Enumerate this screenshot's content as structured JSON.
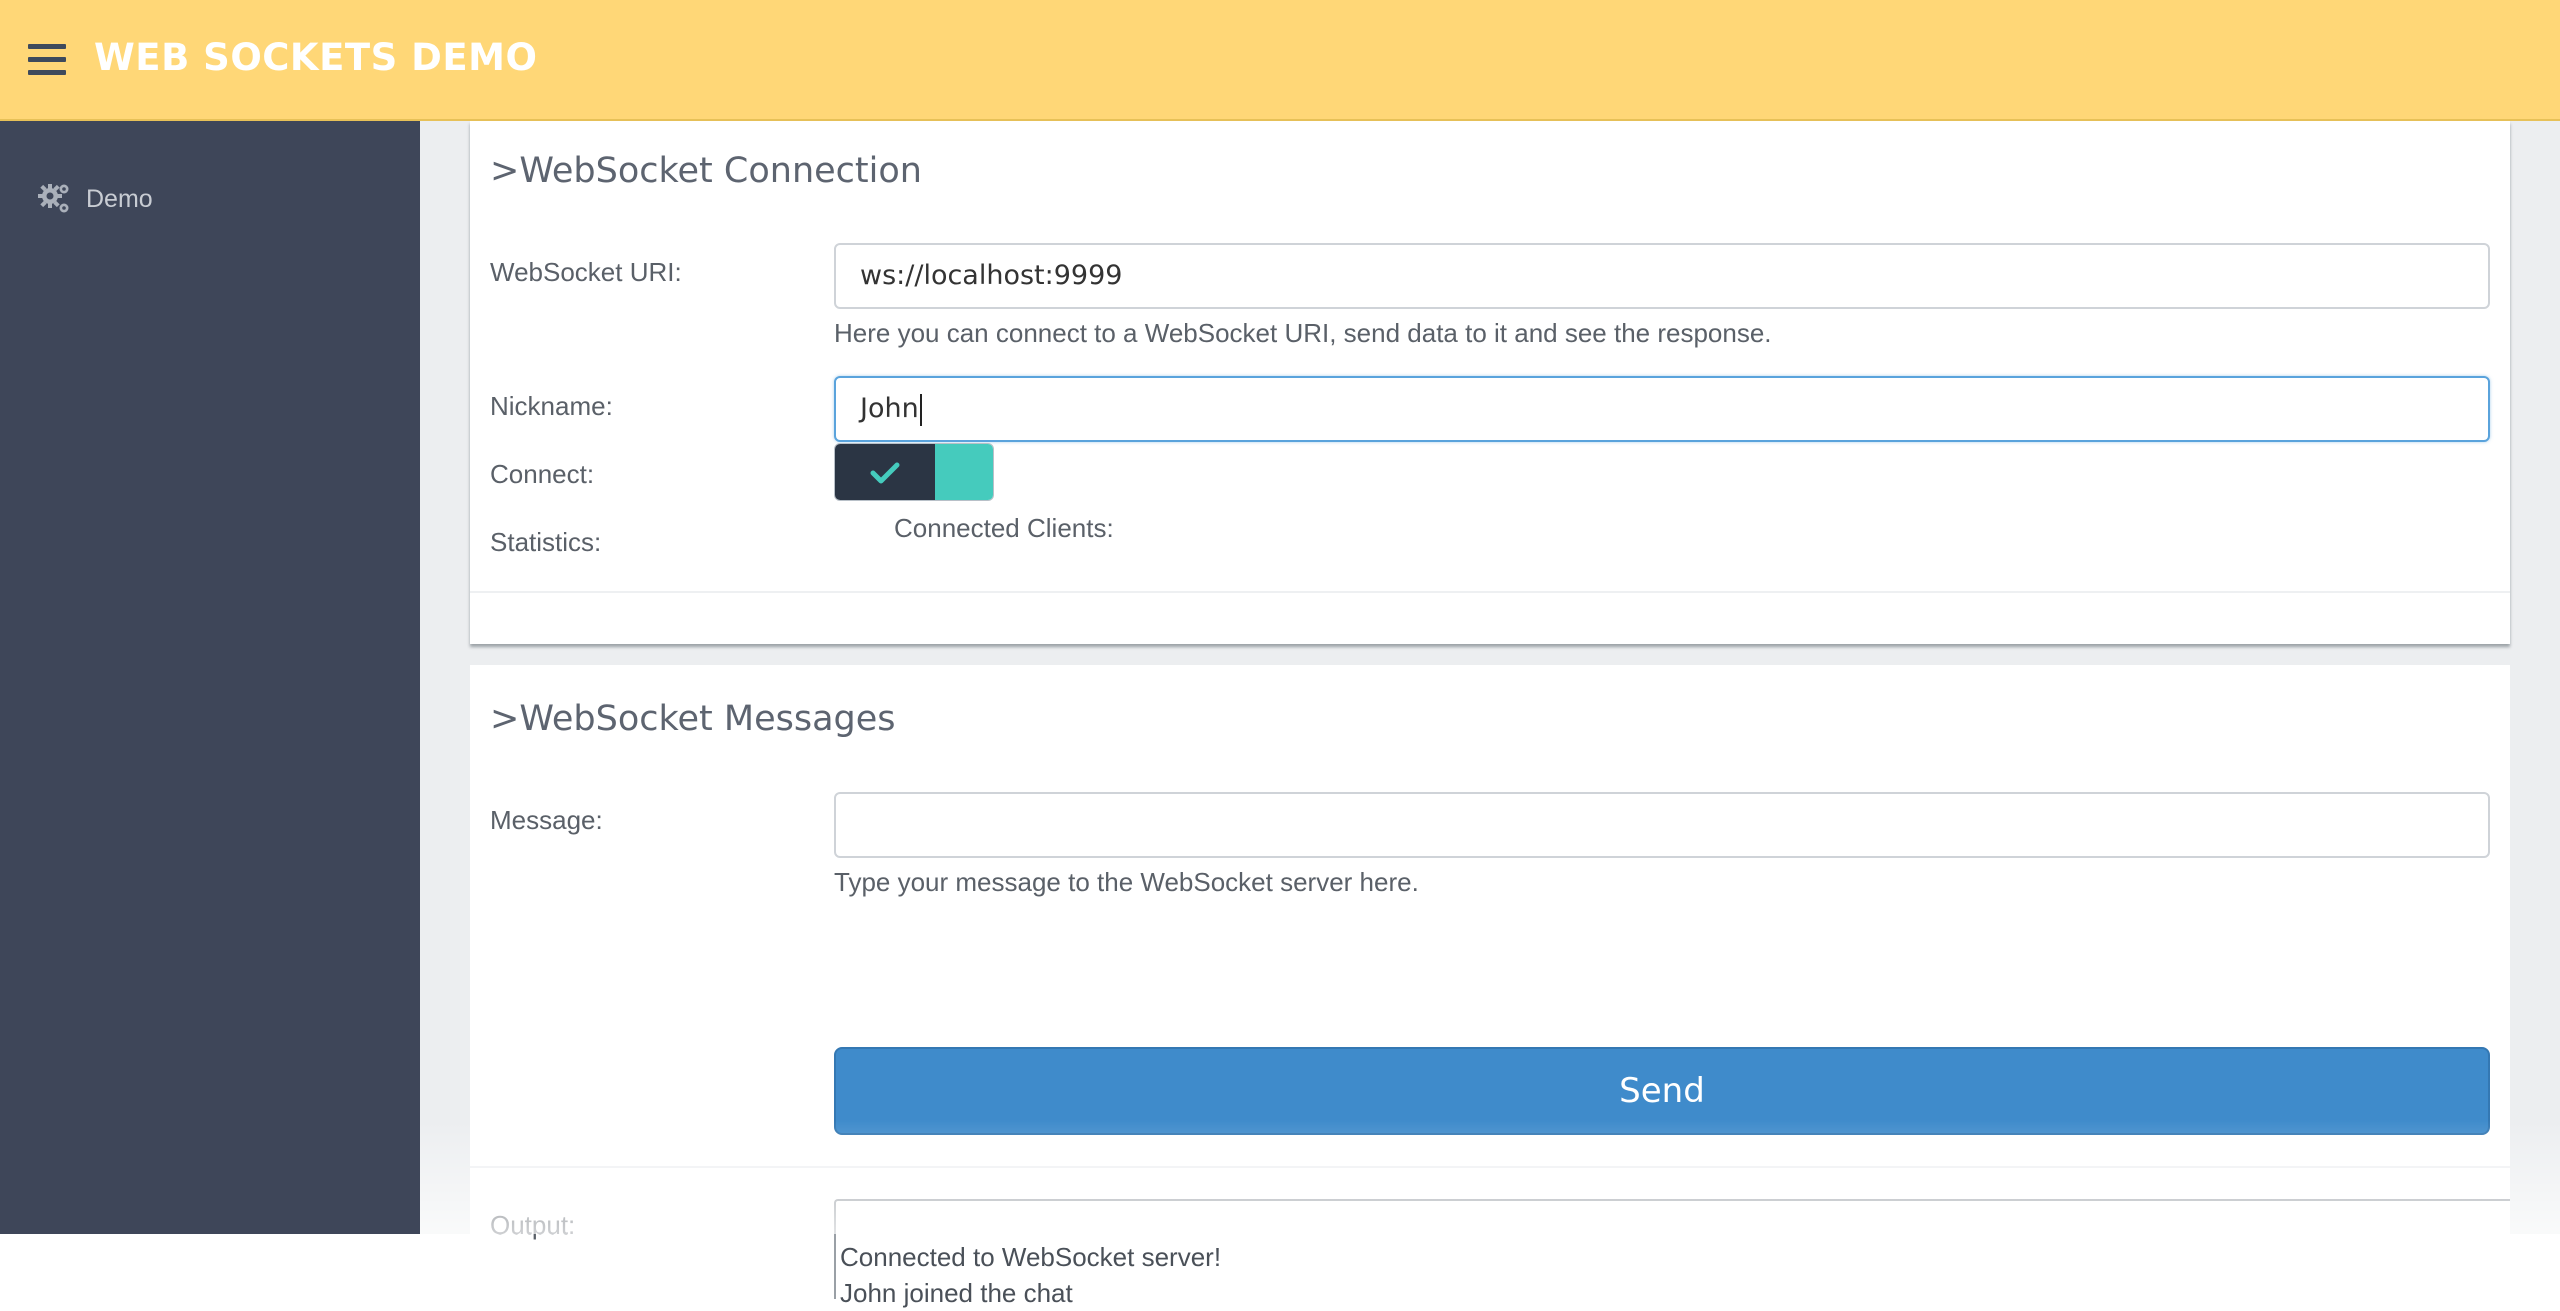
{
  "header": {
    "title": "WEB SOCKETS DEMO",
    "menu_icon": "hamburger-menu-icon",
    "color": "#ffd777"
  },
  "sidebar": {
    "color": "#3e4659",
    "items": [
      {
        "label": "Demo",
        "icon": "gears-icon"
      }
    ]
  },
  "connection_panel": {
    "title": ">WebSocket Connection",
    "uri_label": "WebSocket URI:",
    "uri_value": "ws://localhost:9999",
    "uri_help": "Here you can connect to a WebSocket URI, send data to it and see the response.",
    "nickname_label": "Nickname:",
    "nickname_value": "John",
    "connect_label": "Connect:",
    "connect_toggle": {
      "state": "on",
      "icon": "checkmark-icon",
      "on_color": "#2b3544",
      "knob_color": "#45cbbd"
    },
    "statistics_label": "Statistics:",
    "connected_clients_label": "Connected Clients:"
  },
  "messages_panel": {
    "title": ">WebSocket Messages",
    "message_label": "Message:",
    "message_value": "",
    "message_help": "Type your message to the WebSocket server here.",
    "send_label": "Send",
    "send_color": "#3f8bcb",
    "output_label": "Output:",
    "output_lines": [
      "Connected to WebSocket server!",
      "John joined the chat"
    ]
  }
}
